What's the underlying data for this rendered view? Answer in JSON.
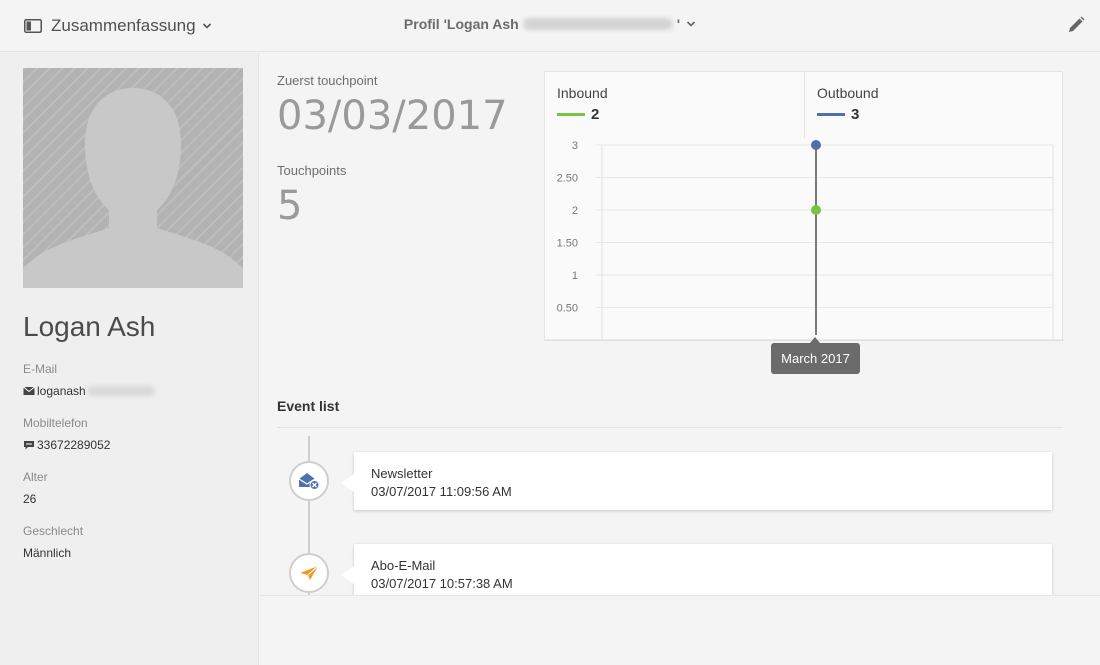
{
  "header": {
    "summary_label": "Zusammenfassung",
    "profile_prefix": "Profil 'Logan Ash",
    "profile_suffix": "'"
  },
  "profile": {
    "name": "Logan Ash",
    "fields": {
      "email_label": "E-Mail",
      "email_value": "loganash",
      "mobile_label": "Mobiltelefon",
      "mobile_value": "33672289052",
      "age_label": "Alter",
      "age_value": "26",
      "gender_label": "Geschlecht",
      "gender_value": "Männlich"
    }
  },
  "stats": {
    "first_touchpoint_label": "Zuerst touchpoint",
    "first_touchpoint_value": "03/03/2017",
    "touchpoints_label": "Touchpoints",
    "touchpoints_value": "5"
  },
  "colors": {
    "inbound": "#7dc242",
    "outbound": "#4f6fad",
    "orange_icon": "#f29a1f",
    "blue_icon": "#4f6fad"
  },
  "legend": {
    "inbound_label": "Inbound",
    "inbound_total": "2",
    "outbound_label": "Outbound",
    "outbound_total": "3"
  },
  "tooltip": "March 2017",
  "chart_data": {
    "type": "line",
    "x": [
      "March 2017"
    ],
    "series": [
      {
        "name": "Inbound",
        "values": [
          2
        ]
      },
      {
        "name": "Outbound",
        "values": [
          3
        ]
      }
    ],
    "yticks": [
      "3",
      "2.50",
      "2",
      "1.50",
      "1",
      "0.50"
    ],
    "ylim": [
      0,
      3
    ],
    "grid": true,
    "legend_position": "top"
  },
  "events": {
    "title": "Event list",
    "items": [
      {
        "name": "Newsletter",
        "date": "03/07/2017 11:09:56 AM",
        "icon": "envelope-x-icon"
      },
      {
        "name": "Abo-E-Mail",
        "date": "03/07/2017 10:57:38 AM",
        "icon": "paper-plane-icon"
      }
    ]
  }
}
